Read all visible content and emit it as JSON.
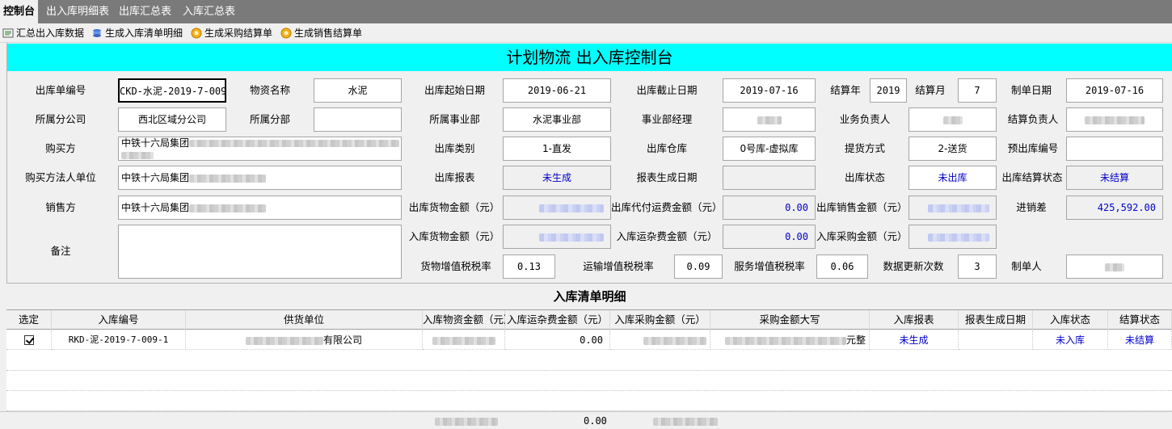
{
  "tabs": [
    {
      "label": "控制台",
      "active": true
    },
    {
      "label": "出入库明细表",
      "active": false
    },
    {
      "label": "出库汇总表",
      "active": false
    },
    {
      "label": "入库汇总表",
      "active": false
    }
  ],
  "toolbar": [
    {
      "label": "汇总出入库数据",
      "icon": "summary-icon"
    },
    {
      "label": "生成入库清单明细",
      "icon": "stack-icon"
    },
    {
      "label": "生成采购结算单",
      "icon": "gear-coin-icon"
    },
    {
      "label": "生成销售结算单",
      "icon": "gear-coin-icon"
    }
  ],
  "title": "计划物流 出入库控制台",
  "form": {
    "out_no": {
      "label": "出库单编号",
      "value": "CKD-水泥-2019-7-009"
    },
    "material": {
      "label": "物资名称",
      "value": "水泥"
    },
    "start_date": {
      "label": "出库起始日期",
      "value": "2019-06-21"
    },
    "end_date": {
      "label": "出库截止日期",
      "value": "2019-07-16"
    },
    "settle_year": {
      "label": "结算年",
      "value": "2019"
    },
    "settle_month": {
      "label": "结算月",
      "value": "7"
    },
    "create_date": {
      "label": "制单日期",
      "value": "2019-07-16"
    },
    "branch": {
      "label": "所属分公司",
      "value": "西北区域分公司"
    },
    "division": {
      "label": "所属分部",
      "value": ""
    },
    "biz_dept": {
      "label": "所属事业部",
      "value": "水泥事业部"
    },
    "dept_manager": {
      "label": "事业部经理"
    },
    "biz_owner": {
      "label": "业务负责人"
    },
    "settle_owner": {
      "label": "结算负责人"
    },
    "buyer": {
      "label": "购买方",
      "value": "中铁十六局集团"
    },
    "out_type": {
      "label": "出库类别",
      "value": "1-直发"
    },
    "warehouse": {
      "label": "出库仓库",
      "value": "0号库-虚拟库"
    },
    "delivery": {
      "label": "提货方式",
      "value": "2-送货"
    },
    "pre_out_no": {
      "label": "预出库编号",
      "value": ""
    },
    "buyer_legal": {
      "label": "购买方法人单位",
      "value": "中铁十六局集团"
    },
    "out_report": {
      "label": "出库报表",
      "value": "未生成"
    },
    "report_date": {
      "label": "报表生成日期",
      "value": ""
    },
    "out_status": {
      "label": "出库状态",
      "value": "未出库"
    },
    "out_settle_status": {
      "label": "出库结算状态",
      "value": "未结算"
    },
    "seller": {
      "label": "销售方",
      "value": "中铁十六局集团"
    },
    "out_goods_amt": {
      "label": "出库货物金额（元）"
    },
    "out_freight_amt": {
      "label": "出库代付运费金额（元）",
      "value": "0.00"
    },
    "out_sales_amt": {
      "label": "出库销售金额（元）"
    },
    "price_diff": {
      "label": "进销差",
      "value": "425,592.00"
    },
    "remark": {
      "label": "备注",
      "value": ""
    },
    "in_goods_amt": {
      "label": "入库货物金额（元）"
    },
    "in_freight_amt": {
      "label": "入库运杂费金额（元）",
      "value": "0.00"
    },
    "in_purchase_amt": {
      "label": "入库采购金额（元）"
    },
    "goods_vat": {
      "label": "货物增值税税率",
      "value": "0.13"
    },
    "transport_vat": {
      "label": "运输增值税税率",
      "value": "0.09"
    },
    "service_vat": {
      "label": "服务增值税税率",
      "value": "0.06"
    },
    "update_count": {
      "label": "数据更新次数",
      "value": "3"
    },
    "maker": {
      "label": "制单人"
    }
  },
  "grid": {
    "title": "入库清单明细",
    "headers": [
      "选定",
      "入库编号",
      "供货单位",
      "入库物资金额（元）",
      "入库运杂费金额（元）",
      "入库采购金额（元）",
      "采购金额大写",
      "入库报表",
      "报表生成日期",
      "入库状态",
      "结算状态"
    ],
    "rows": [
      {
        "checked": true,
        "in_no": "RKD-泥-2019-7-009-1",
        "supplier": "有限公司",
        "goods_amt": "",
        "freight_amt": "0.00",
        "purchase_amt": "",
        "amount_words": "元整",
        "report": "未生成",
        "report_date": "",
        "status": "未入库",
        "settle_status": "未结算"
      }
    ],
    "footer": {
      "freight_total": "0.00"
    }
  }
}
